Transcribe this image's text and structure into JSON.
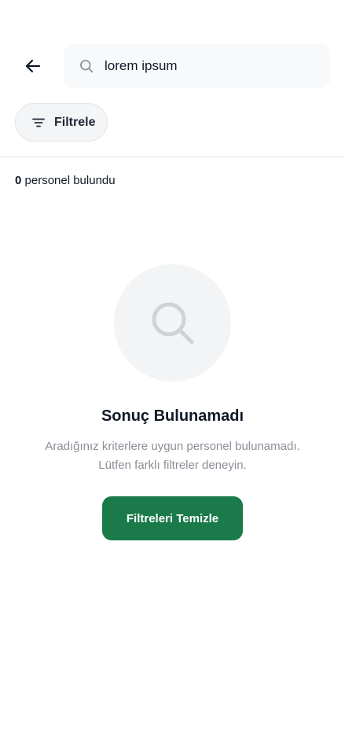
{
  "header": {
    "back_icon": "arrow-left-icon",
    "search": {
      "icon": "search-icon",
      "value": "lorem ipsum",
      "placeholder": ""
    }
  },
  "filter": {
    "icon": "filter-lines-icon",
    "label": "Filtrele"
  },
  "results": {
    "count": "0",
    "label": " personel bulundu"
  },
  "empty_state": {
    "icon": "search-icon",
    "title": "Sonuç Bulunamadı",
    "description": "Aradığınız kriterlere uygun personel bulunamadı. Lütfen farklı filtreler deneyin.",
    "button_label": "Filtreleri Temizle"
  },
  "colors": {
    "primary": "#1a7a4a",
    "text": "#111827",
    "muted": "#8b8f97",
    "surface": "#f3f4f6"
  }
}
